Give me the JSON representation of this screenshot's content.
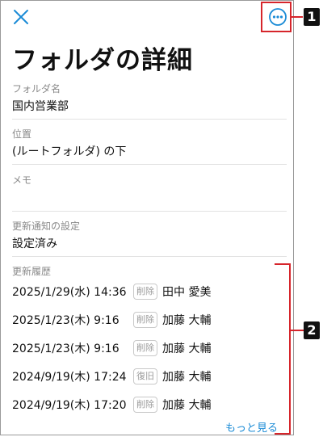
{
  "colors": {
    "accent": "#1a8bd6",
    "callout": "#d6252b"
  },
  "icons": {
    "close": "close-icon",
    "more": "more-horizontal-circle-icon"
  },
  "page_title": "フォルダの詳細",
  "fields": [
    {
      "label": "フォルダ名",
      "value": "国内営業部"
    },
    {
      "label": "位置",
      "value": "(ルートフォルダ) の下"
    },
    {
      "label": "メモ",
      "value": ""
    },
    {
      "label": "更新通知の設定",
      "value": "設定済み"
    }
  ],
  "history": {
    "label": "更新履歴",
    "rows": [
      {
        "date": "2025/1/29(水) 14:36",
        "action": "削除",
        "user": "田中 愛美"
      },
      {
        "date": "2025/1/23(木) 9:16",
        "action": "削除",
        "user": "加藤 大輔"
      },
      {
        "date": "2025/1/23(木) 9:16",
        "action": "削除",
        "user": "加藤 大輔"
      },
      {
        "date": "2024/9/19(木) 17:24",
        "action": "復旧",
        "user": "加藤 大輔"
      },
      {
        "date": "2024/9/19(木) 17:20",
        "action": "削除",
        "user": "加藤 大輔"
      }
    ],
    "more": "もっと見る"
  },
  "callouts": {
    "one": "1",
    "two": "2"
  }
}
